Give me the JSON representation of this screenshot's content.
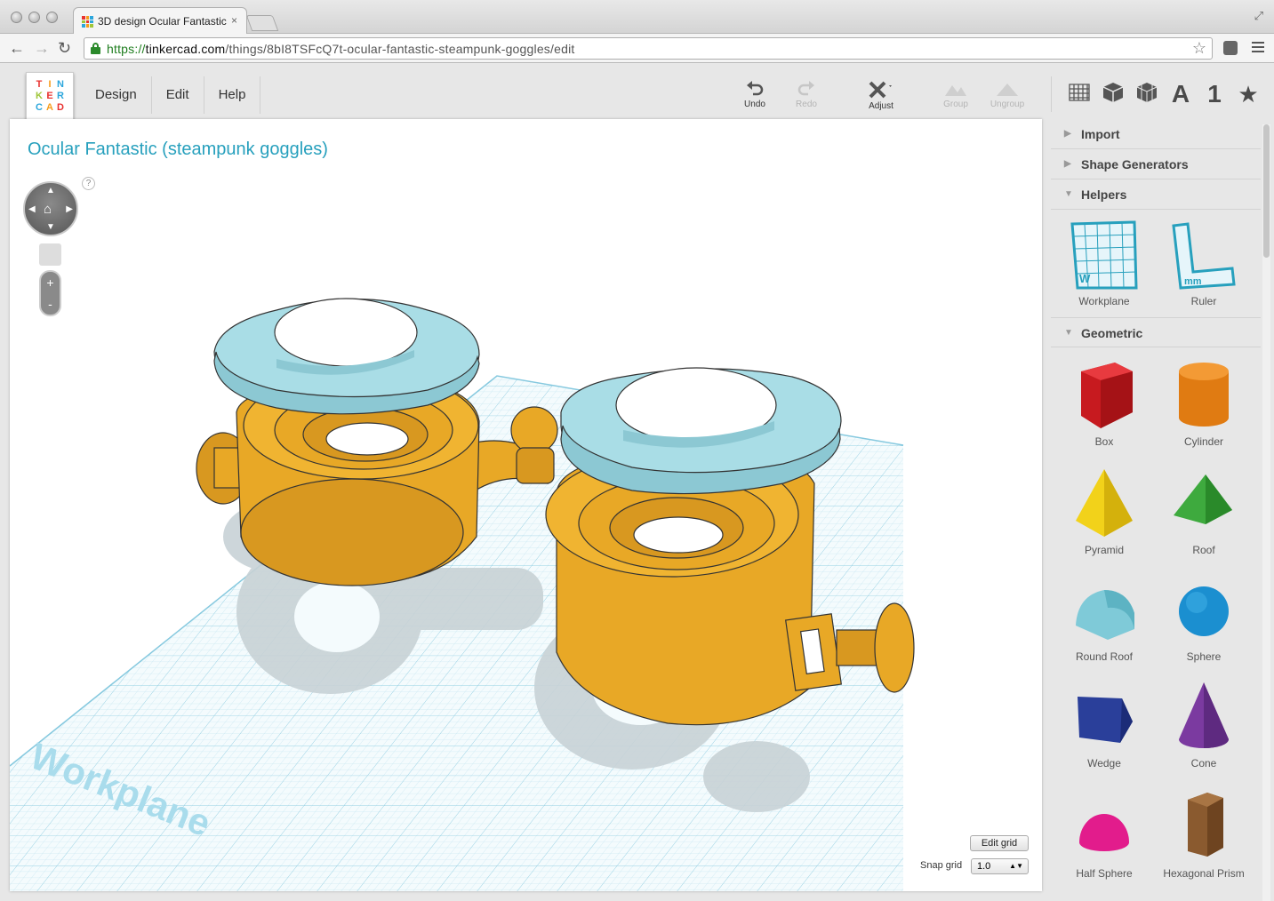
{
  "browser": {
    "tab_title": "3D design Ocular Fantastic",
    "tab_close": "×",
    "url_scheme": "https://",
    "url_host": "tinkercad.com",
    "url_path": "/things/8bI8TSFcQ7t-ocular-fantastic-steampunk-goggles/edit",
    "back_icon": "←",
    "forward_icon": "→",
    "reload_icon": "↻",
    "star_icon": "☆",
    "fullscreen_icon": "⤢"
  },
  "app": {
    "logo_letters": [
      "T",
      "I",
      "N",
      "K",
      "E",
      "R",
      "C",
      "A",
      "D"
    ],
    "logo_colors": [
      "#e8312f",
      "#f79c1a",
      "#2ba6dc",
      "#9fc63a",
      "#e8312f",
      "#2ba6dc",
      "#2ba6dc",
      "#f79c1a",
      "#e8312f"
    ],
    "menu": [
      "Design",
      "Edit",
      "Help"
    ],
    "tools": {
      "undo": "Undo",
      "redo": "Redo",
      "adjust": "Adjust",
      "group": "Group",
      "ungroup": "Ungroup"
    },
    "view_icons": {
      "letter": "A",
      "number": "1",
      "star": "★"
    }
  },
  "canvas": {
    "title": "Ocular Fantastic (steampunk goggles)",
    "workplane_label": "Workplane",
    "help": "?",
    "zoom_in": "+",
    "zoom_out": "-",
    "edit_grid": "Edit grid",
    "snap_label": "Snap grid",
    "snap_value": "1.0",
    "snap_arrow": "▲▼"
  },
  "panel": {
    "sections": {
      "import": "Import",
      "shape_generators": "Shape Generators",
      "helpers": "Helpers",
      "geometric": "Geometric"
    },
    "helpers": [
      "Workplane",
      "Ruler"
    ],
    "helper_marks": {
      "workplane": "W",
      "ruler": "mm"
    },
    "shapes": [
      "Box",
      "Cylinder",
      "Pyramid",
      "Roof",
      "Round Roof",
      "Sphere",
      "Wedge",
      "Cone",
      "Half Sphere",
      "Hexagonal Prism"
    ]
  },
  "colors": {
    "accent": "#27a0bd",
    "grid": "#bfe3ef",
    "goggle_body": "#e8a826",
    "goggle_lens_ring": "#a9dde6",
    "shadow": "#c8d2d6"
  }
}
